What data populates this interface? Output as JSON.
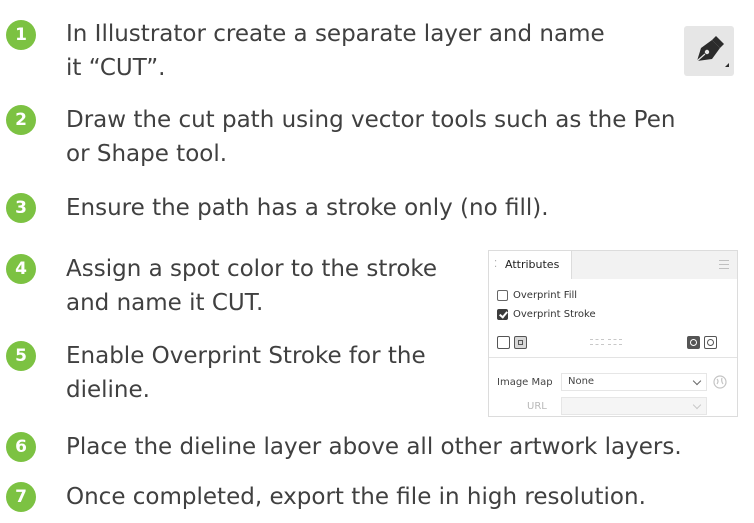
{
  "steps": [
    {
      "num": "1",
      "line1": "In Illustrator create a separate layer and name",
      "line2": "it “CUT”."
    },
    {
      "num": "2",
      "line1": "Draw the cut path using vector tools such as the Pen",
      "line2": "or Shape tool."
    },
    {
      "num": "3",
      "line1": "Ensure the path has a stroke only (no fill)."
    },
    {
      "num": "4",
      "line1": "Assign a spot color to the stroke",
      "line2": "and name it CUT."
    },
    {
      "num": "5",
      "line1": "Enable Overprint Stroke for the",
      "line2": "dieline."
    },
    {
      "num": "6",
      "line1": "Place the dieline layer above all other artwork layers."
    },
    {
      "num": "7",
      "line1": "Once completed, export the file in high resolution."
    }
  ],
  "pen_tool": {
    "icon": "pen-tool-icon"
  },
  "attributes_panel": {
    "tab_label": "Attributes",
    "overprint_fill_label": "Overprint Fill",
    "overprint_fill_checked": false,
    "overprint_stroke_label": "Overprint Stroke",
    "overprint_stroke_checked": true,
    "image_map_label": "Image Map",
    "image_map_value": "None",
    "url_label": "URL",
    "url_value": ""
  },
  "colors": {
    "accent": "#7cc242",
    "text": "#404040"
  }
}
